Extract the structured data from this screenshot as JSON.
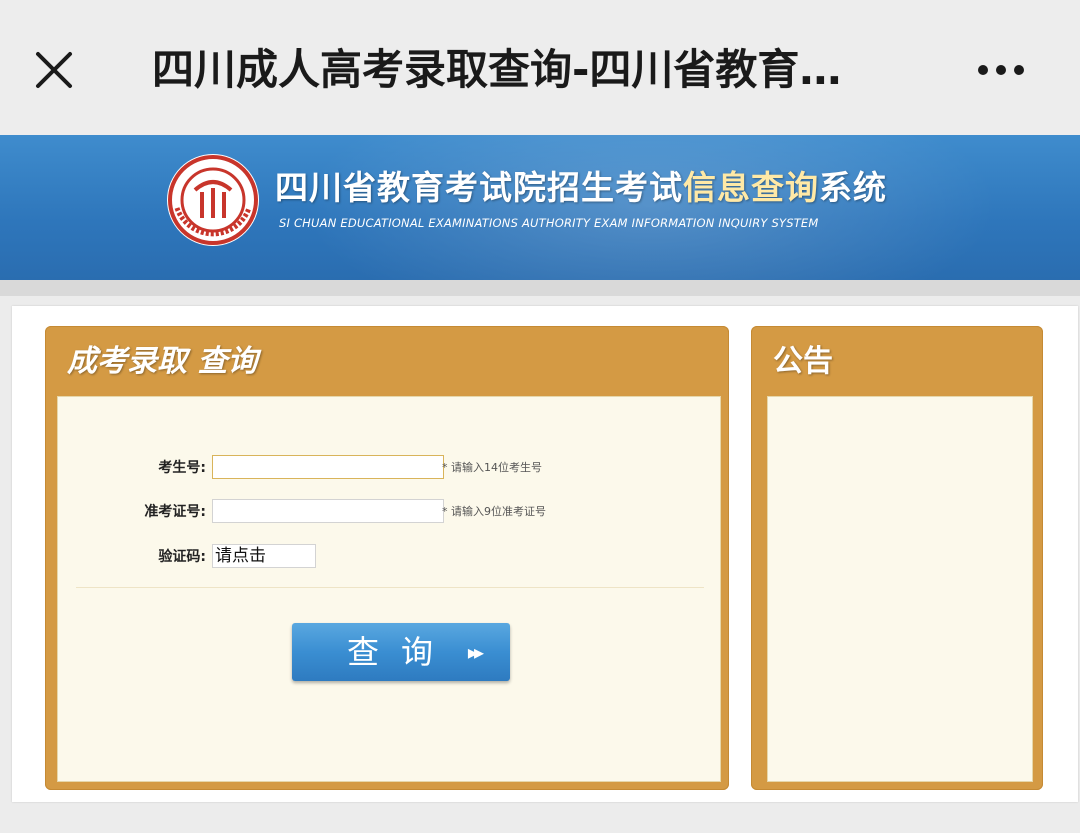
{
  "browser": {
    "title": "四川成人高考录取查询-四川省教育…",
    "close_icon": "close-icon",
    "more_icon": "more-icon"
  },
  "banner": {
    "title_main": "四川省教育考试院招生考试",
    "title_highlight": "信息查询",
    "title_tail": "系统",
    "subtitle": "SI CHUAN EDUCATIONAL EXAMINATIONS AUTHORITY EXAM INFORMATION INQUIRY SYSTEM",
    "logo_icon": "seal-logo-icon",
    "colors": {
      "primary": "#2e76bb",
      "highlight": "#ffe9a6"
    }
  },
  "query_panel": {
    "title": "成考录取  查询",
    "fields": {
      "exam_number": {
        "label": "考生号:",
        "value": "",
        "hint": "* 请输入14位考生号"
      },
      "admission_ticket": {
        "label": "准考证号:",
        "value": "",
        "hint": "* 请输入9位准考证号"
      },
      "captcha": {
        "label": "验证码:",
        "value": "请点击"
      }
    },
    "submit_label": "查询",
    "submit_icon": "double-chevron-right-icon",
    "colors": {
      "panel": "#d49a44",
      "button": "#3a8ed2"
    }
  },
  "notice_panel": {
    "title": "公告"
  }
}
